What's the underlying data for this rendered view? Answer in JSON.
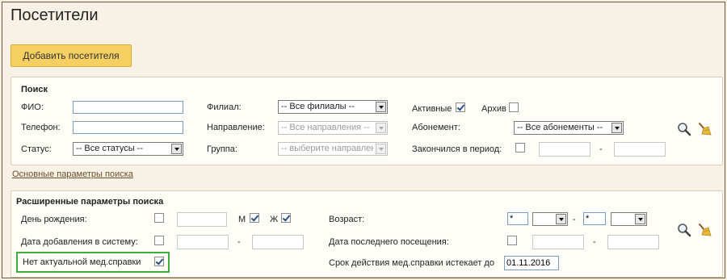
{
  "page_title": "Посетители",
  "add_button": "Добавить посетителя",
  "search": {
    "heading": "Поиск",
    "fio_label": "ФИО:",
    "fio_value": "",
    "phone_label": "Телефон:",
    "phone_value": "",
    "status_label": "Статус:",
    "status_value": "-- Все статусы --",
    "branch_label": "Филиал:",
    "branch_value": "-- Все филиалы --",
    "direction_label": "Направление:",
    "direction_value": "-- Все направления --",
    "group_label": "Группа:",
    "group_value": "-- выберите направление --",
    "active_label": "Активные",
    "active_checked": true,
    "archive_label": "Архив",
    "archive_checked": false,
    "subscription_label": "Абонемент:",
    "subscription_value": "-- Все абонементы --",
    "ended_label": "Закончился в период:",
    "ended_from": "",
    "ended_dash": "-",
    "ended_to": ""
  },
  "basic_params_link": "Основные параметры поиска",
  "extended": {
    "heading": "Расширенные параметры поиска",
    "birthday_label": "День рождения:",
    "m_label": "М",
    "m_checked": true,
    "f_label": "Ж",
    "f_checked": true,
    "added_label": "Дата добавления в систему:",
    "added_dash": "-",
    "no_cert_label": "Нет актуальной мед.справки",
    "no_cert_checked": true,
    "age_label": "Возраст:",
    "age_from": "*",
    "age_dash": "-",
    "age_to": "*",
    "last_visit_label": "Дата последнего посещения:",
    "last_visit_dash": "-",
    "cert_expires_label": "Срок действия мед.справки истекает до",
    "cert_expires_value": "01.11.2016"
  },
  "icons": {
    "search": "magnifier-icon",
    "clear": "broom-icon"
  }
}
